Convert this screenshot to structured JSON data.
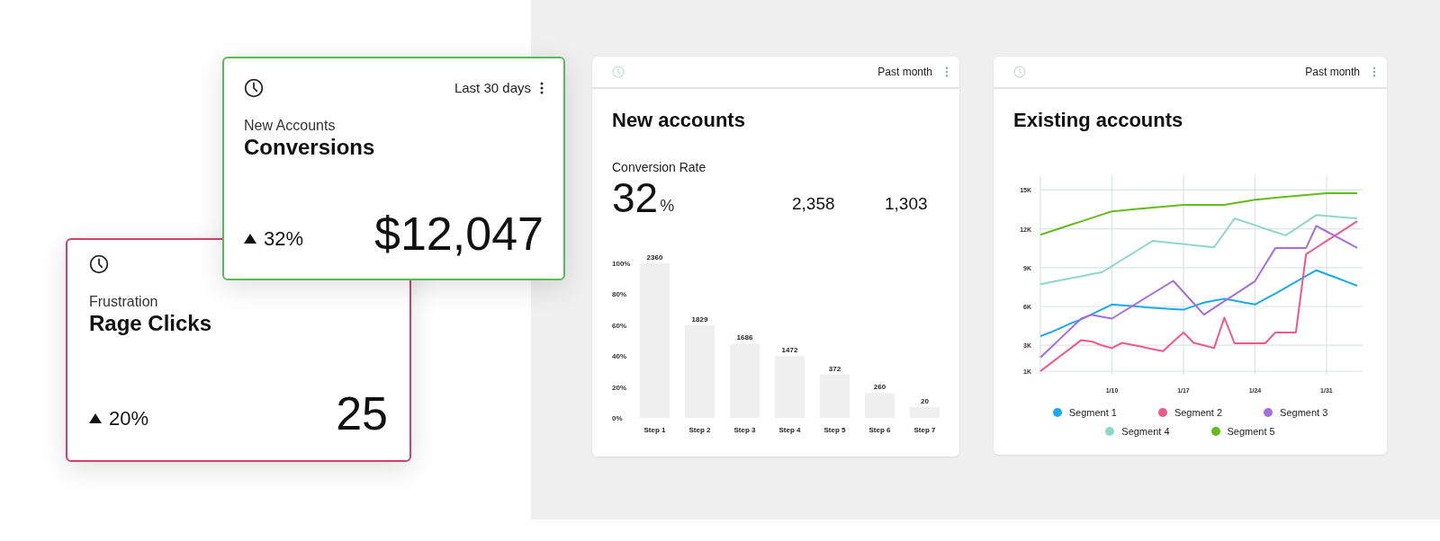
{
  "kpi_cards": [
    {
      "range": "Last 30 days",
      "has_menu": true,
      "category": "New Accounts",
      "title": "Conversions",
      "change": "32%",
      "value": "$12,047",
      "color": "#5cb85c"
    },
    {
      "category": "Frustration",
      "title": "Rage Clicks",
      "change": "20%",
      "value": "25",
      "color": "#d2406e"
    }
  ],
  "panels": [
    {
      "range": "Past month",
      "title": "New accounts",
      "metric_label": "Conversion Rate",
      "metric_value": "32",
      "metric_unit": "%",
      "stats": [
        "2,358",
        "1,303"
      ],
      "bar_counts": [
        "2360",
        "1829",
        "1686",
        "1472",
        "372",
        "260",
        "20"
      ],
      "chart_data": {
        "type": "bar",
        "categories": [
          "Step 1",
          "Step 2",
          "Step 3",
          "Step 4",
          "Step 5",
          "Step 6",
          "Step 7"
        ],
        "values": [
          100,
          60,
          48,
          40,
          28,
          16,
          7
        ],
        "ylim": [
          0,
          100
        ],
        "yticks": [
          {
            "value": 0,
            "label": "0%"
          },
          {
            "value": 20,
            "label": "20%"
          },
          {
            "value": 40,
            "label": "40%"
          },
          {
            "value": 60,
            "label": "60%"
          },
          {
            "value": 80,
            "label": "80%"
          },
          {
            "value": 100,
            "label": "100%"
          }
        ]
      }
    },
    {
      "range": "Past month",
      "title": "Existing accounts",
      "chart_data": {
        "type": "line",
        "categories": [
          null,
          null,
          null,
          null,
          null,
          null,
          null,
          "1/10",
          null,
          null,
          null,
          null,
          null,
          null,
          "1/17",
          null,
          null,
          null,
          null,
          null,
          null,
          "1/24",
          null,
          null,
          null,
          null,
          null,
          null,
          "1/31",
          null,
          null,
          null
        ],
        "grid": true,
        "ylim": [
          1000,
          16000
        ],
        "yticks": [
          {
            "value": 1000,
            "label": "1K"
          },
          {
            "value": 3000,
            "label": "3K"
          },
          {
            "value": 6000,
            "label": "6K"
          },
          {
            "value": 9000,
            "label": "9K"
          },
          {
            "value": 12000,
            "label": "12K"
          },
          {
            "value": 15000,
            "label": "15K"
          }
        ],
        "series": [
          {
            "name": "Segment 1",
            "color": "#1aaaee",
            "values": [
              3700,
              4000,
              4350,
              4700,
              5000,
              5380,
              5770,
              6150,
              6090,
              6030,
              5960,
              5900,
              5850,
              5800,
              5750,
              6030,
              6300,
              6450,
              6600,
              6450,
              6300,
              6150,
              6580,
              7000,
              7450,
              7900,
              8350,
              8800,
              8500,
              8200,
              7900,
              7600
            ]
          },
          {
            "name": "Segment 2",
            "color": "#f0578a",
            "values": [
              1000,
              1600,
              2200,
              2800,
              3400,
              3300,
              3000,
              2780,
              3190,
              3030,
              2870,
              2700,
              2540,
              3270,
              3990,
              3190,
              2990,
              2780,
              5130,
              3150,
              3150,
              3150,
              3150,
              3990,
              3990,
              3990,
              10040,
              10550,
              11060,
              11560,
              12070,
              12580
            ]
          },
          {
            "name": "Segment 3",
            "color": "#a46ee0",
            "values": [
              2060,
              2810,
              3560,
              4310,
              5060,
              5360,
              5210,
              5060,
              5550,
              6030,
              6520,
              7010,
              7490,
              7980,
              7110,
              6240,
              5370,
              5890,
              6410,
              6920,
              7440,
              7960,
              9240,
              10520,
              10520,
              10520,
              10520,
              12220,
              11800,
              11370,
              10950,
              10520
            ]
          },
          {
            "name": "Segment 4",
            "color": "#8ed8c8",
            "values": [
              7720,
              7870,
              8030,
              8180,
              8330,
              8490,
              8640,
              9120,
              9610,
              10090,
              10580,
              11060,
              10980,
              10900,
              10820,
              10730,
              10650,
              10570,
              11690,
              12800,
              12540,
              12280,
              12010,
              11750,
              11490,
              12010,
              12540,
              13060,
              12990,
              12930,
              12860,
              12800
            ]
          },
          {
            "name": "Segment 5",
            "color": "#64bc1c",
            "values": [
              11540,
              11800,
              12060,
              12320,
              12570,
              12830,
              13090,
              13350,
              13420,
              13490,
              13560,
              13630,
              13700,
              13770,
              13840,
              13840,
              13840,
              13840,
              13840,
              13980,
              14110,
              14250,
              14320,
              14400,
              14470,
              14540,
              14610,
              14690,
              14760,
              14760,
              14760,
              14760
            ]
          }
        ]
      }
    }
  ]
}
